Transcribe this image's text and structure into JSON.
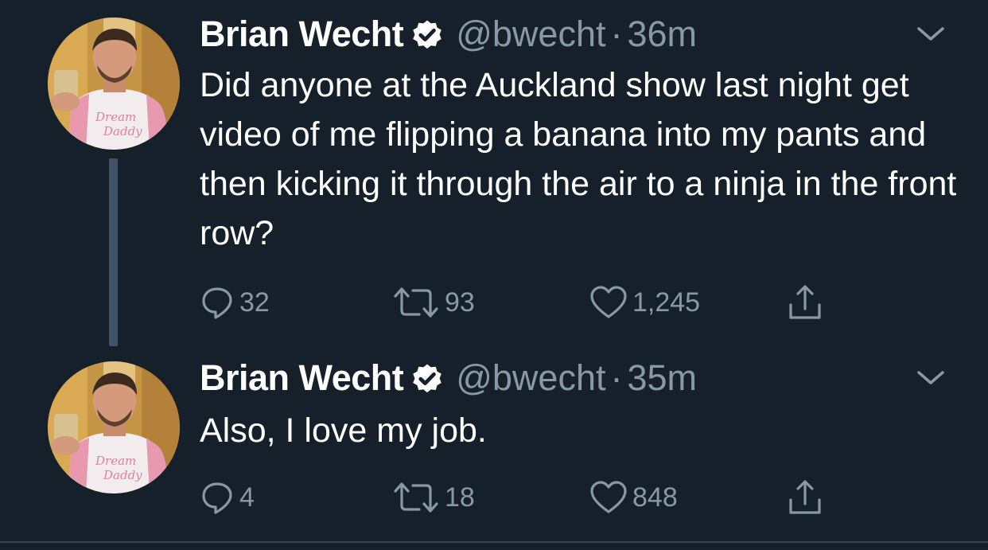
{
  "tweets": [
    {
      "author_name": "Brian Wecht",
      "handle": "@bwecht",
      "separator": "·",
      "time": "36m",
      "text": "Did anyone at the Auckland show last night get video of me flipping a banana into my pants and then kicking it through the air to a ninja in the front row?",
      "replies": "32",
      "retweets": "93",
      "likes": "1,245",
      "avatar_shirt_text": [
        "Dream",
        "Daddy"
      ]
    },
    {
      "author_name": "Brian Wecht",
      "handle": "@bwecht",
      "separator": "·",
      "time": "35m",
      "text": "Also, I love my job.",
      "replies": "4",
      "retweets": "18",
      "likes": "848",
      "avatar_shirt_text": [
        "Dream",
        "Daddy"
      ]
    }
  ],
  "icons": {
    "verified": "verified-badge-icon",
    "caret": "chevron-down-icon",
    "reply": "reply-icon",
    "retweet": "retweet-icon",
    "like": "heart-icon",
    "share": "share-icon"
  },
  "colors": {
    "background": "#15202b",
    "text_primary": "#ffffff",
    "text_secondary": "#8899a6",
    "thread_line": "#3d5466"
  }
}
